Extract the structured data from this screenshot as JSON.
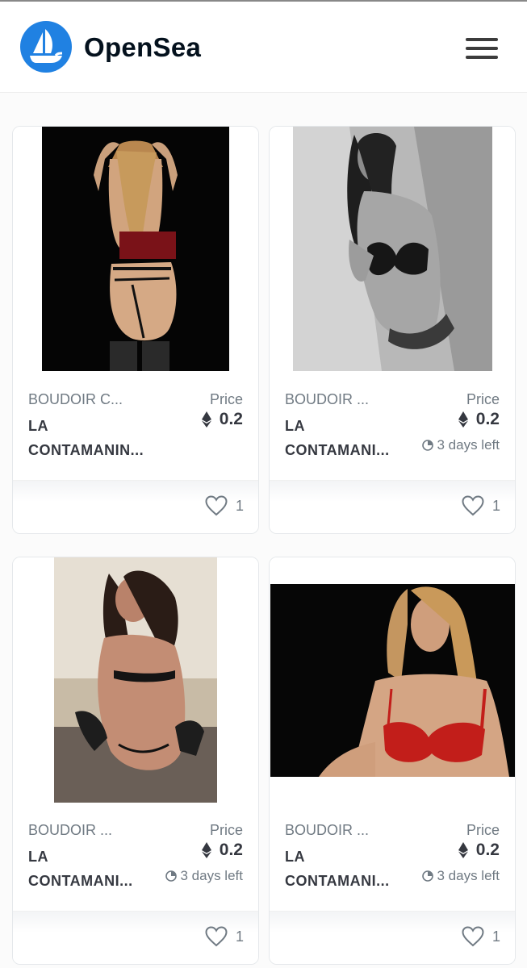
{
  "header": {
    "brand": "OpenSea",
    "logo_icon": "boat-logo-icon",
    "menu_icon": "hamburger-menu-icon",
    "brand_color": "#2081e2"
  },
  "cards": [
    {
      "image": "photo-woman-red-lingerie-back-view",
      "collection": "BOUDOIR C...",
      "name": "LA CONTAMANIN...",
      "price_label": "Price",
      "price": "0.2",
      "currency_icon": "ethereum-icon",
      "time_left": "",
      "favorites": "1"
    },
    {
      "image": "photo-woman-black-lingerie-monochrome",
      "collection": "BOUDOIR ...",
      "name": "LA CONTAMANI...",
      "price_label": "Price",
      "price": "0.2",
      "currency_icon": "ethereum-icon",
      "time_left": "3 days left",
      "favorites": "1"
    },
    {
      "image": "photo-woman-black-lingerie-seated",
      "collection": "BOUDOIR ...",
      "name": "LA CONTAMANI...",
      "price_label": "Price",
      "price": "0.2",
      "currency_icon": "ethereum-icon",
      "time_left": "3 days left",
      "favorites": "1"
    },
    {
      "image": "photo-woman-red-bra",
      "collection": "BOUDOIR ...",
      "name": "LA CONTAMANI...",
      "price_label": "Price",
      "price": "0.2",
      "currency_icon": "ethereum-icon",
      "time_left": "3 days left",
      "favorites": "1"
    }
  ]
}
